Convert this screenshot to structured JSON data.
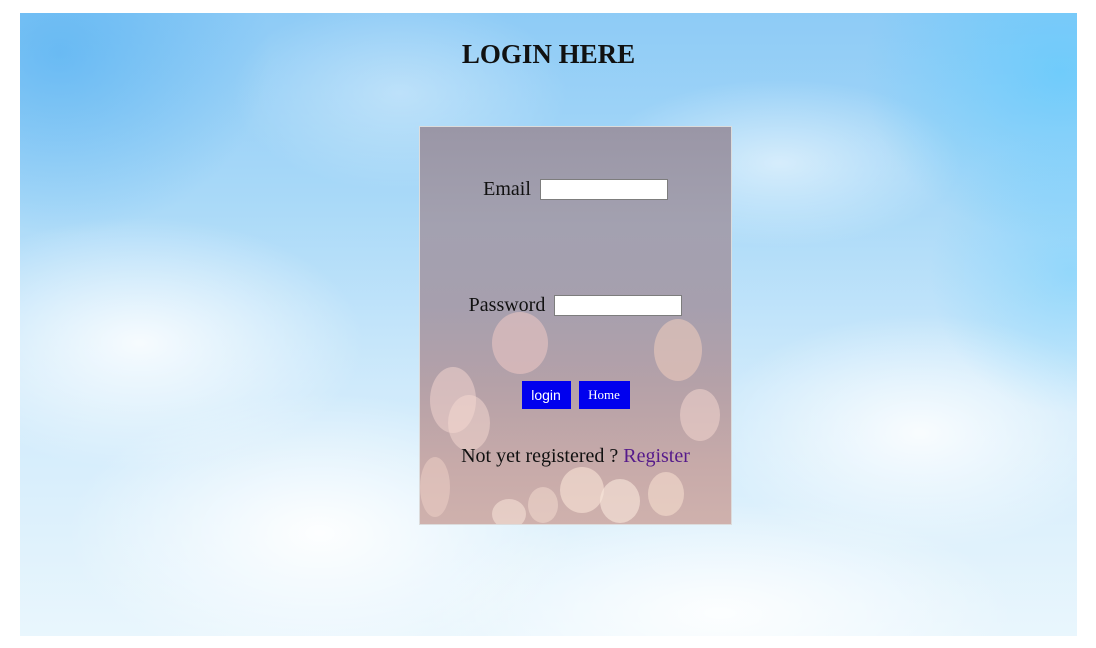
{
  "page": {
    "title": "LOGIN HERE"
  },
  "login_form": {
    "email_label": "Email",
    "email_value": "",
    "password_label": "Password",
    "password_value": "",
    "login_button_label": "login",
    "home_button_label": "Home",
    "register_prompt": "Not yet registered ?",
    "register_link_label": "Register"
  },
  "colors": {
    "button_background": "#0000ee",
    "button_text": "#ffffff",
    "register_link": "#551a8b",
    "title_text": "#111111"
  }
}
